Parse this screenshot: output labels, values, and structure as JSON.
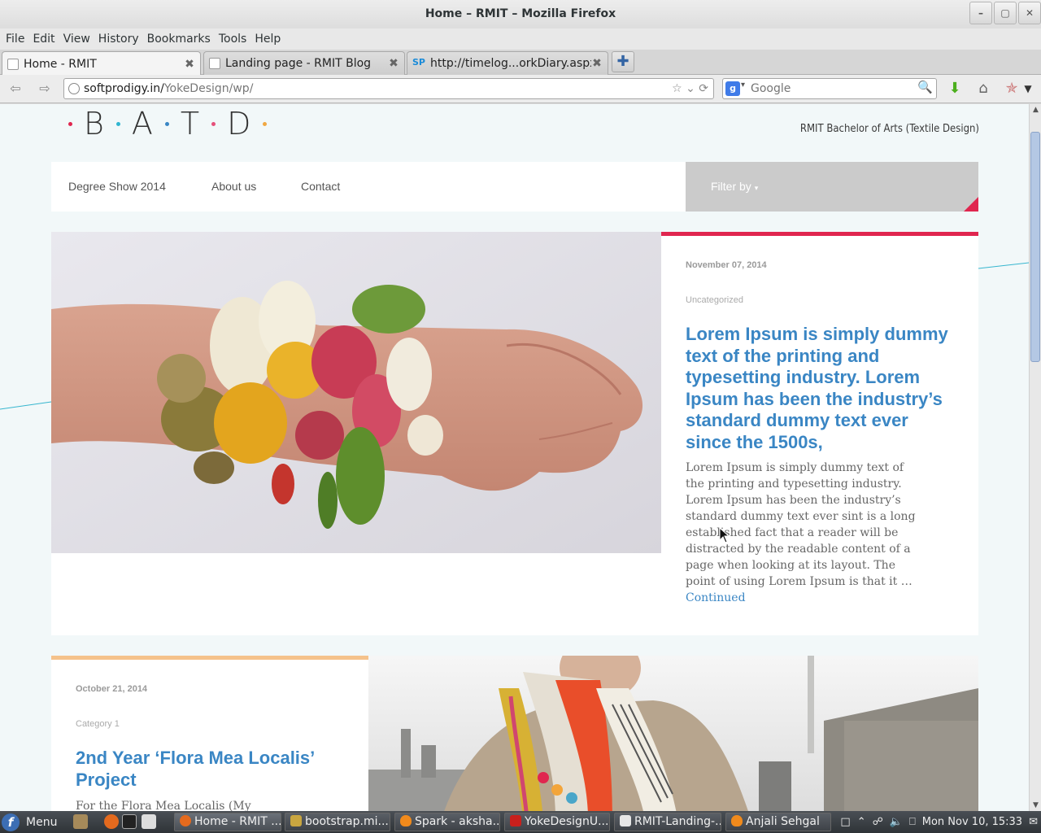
{
  "window": {
    "title": "Home – RMIT – Mozilla Firefox",
    "minimize_icon": "minimize-icon",
    "maximize_icon": "maximize-icon",
    "close_icon": "close-icon"
  },
  "menubar": [
    "File",
    "Edit",
    "View",
    "History",
    "Bookmarks",
    "Tools",
    "Help"
  ],
  "tabs": [
    {
      "label": "Home - RMIT",
      "favicon": "page-icon",
      "active": true
    },
    {
      "label": "Landing page - RMIT Blog",
      "favicon": "page-icon",
      "active": false
    },
    {
      "label": "http://timelog...orkDiary.aspx",
      "favicon": "sp-icon",
      "favicon_text": "SP",
      "active": false
    }
  ],
  "navbar": {
    "url_host": "softprodigy.in/",
    "url_path": "YokeDesign/wp/",
    "search_placeholder": "Google",
    "search_engine_text": "g"
  },
  "site": {
    "logo_letters": [
      "B",
      "A",
      "T",
      "D"
    ],
    "logo_dot_colors": [
      "#e0264f",
      "#2fb5d0",
      "#3a86c4",
      "#e5507a",
      "#f0a742"
    ],
    "tagline": "RMIT Bachelor of Arts (Textile Design)",
    "nav": [
      "Degree Show 2014",
      "About us",
      "Contact"
    ],
    "filter_label": "Filter by",
    "accent_color": "#e0264f",
    "link_color": "#3a86c4"
  },
  "posts": [
    {
      "date": "November 07, 2014",
      "category": "Uncategorized",
      "title": "Lorem Ipsum is simply dummy text of the printing and typesetting industry. Lorem Ipsum has been the industry’s standard dummy text ever since the 1500s,",
      "excerpt": "Lorem Ipsum is simply dummy text of the printing and typesetting industry. Lorem Ipsum has been the industry’s standard dummy text ever sint is a long established fact that a reader will be distracted by the readable content of a page when looking at its layout. The point of using Lorem Ipsum is that it …",
      "more_label": "Continued",
      "image": "knitted-flower-bracelet-photo"
    },
    {
      "date": "October 21, 2014",
      "category": "Category 1",
      "title": "2nd Year ‘Flora Mea Localis’ Project",
      "excerpt": "For the Flora Mea Localis (My",
      "image": "scarf-portrait-photo"
    }
  ],
  "taskbar": {
    "menu_label": "Menu",
    "tasks": [
      {
        "label": "Home - RMIT ...",
        "icon": "firefox-icon",
        "active": true
      },
      {
        "label": "bootstrap.mi...",
        "icon": "filemanager-icon",
        "active": false
      },
      {
        "label": "Spark - aksha...",
        "icon": "spark-icon",
        "active": false
      },
      {
        "label": "YokeDesignU...",
        "icon": "filezilla-icon",
        "active": false
      },
      {
        "label": "RMIT-Landing-...",
        "icon": "document-icon",
        "active": false
      },
      {
        "label": "Anjali Sehgal",
        "icon": "spark-icon",
        "active": false
      }
    ],
    "clock": "Mon Nov 10, 15:33"
  }
}
